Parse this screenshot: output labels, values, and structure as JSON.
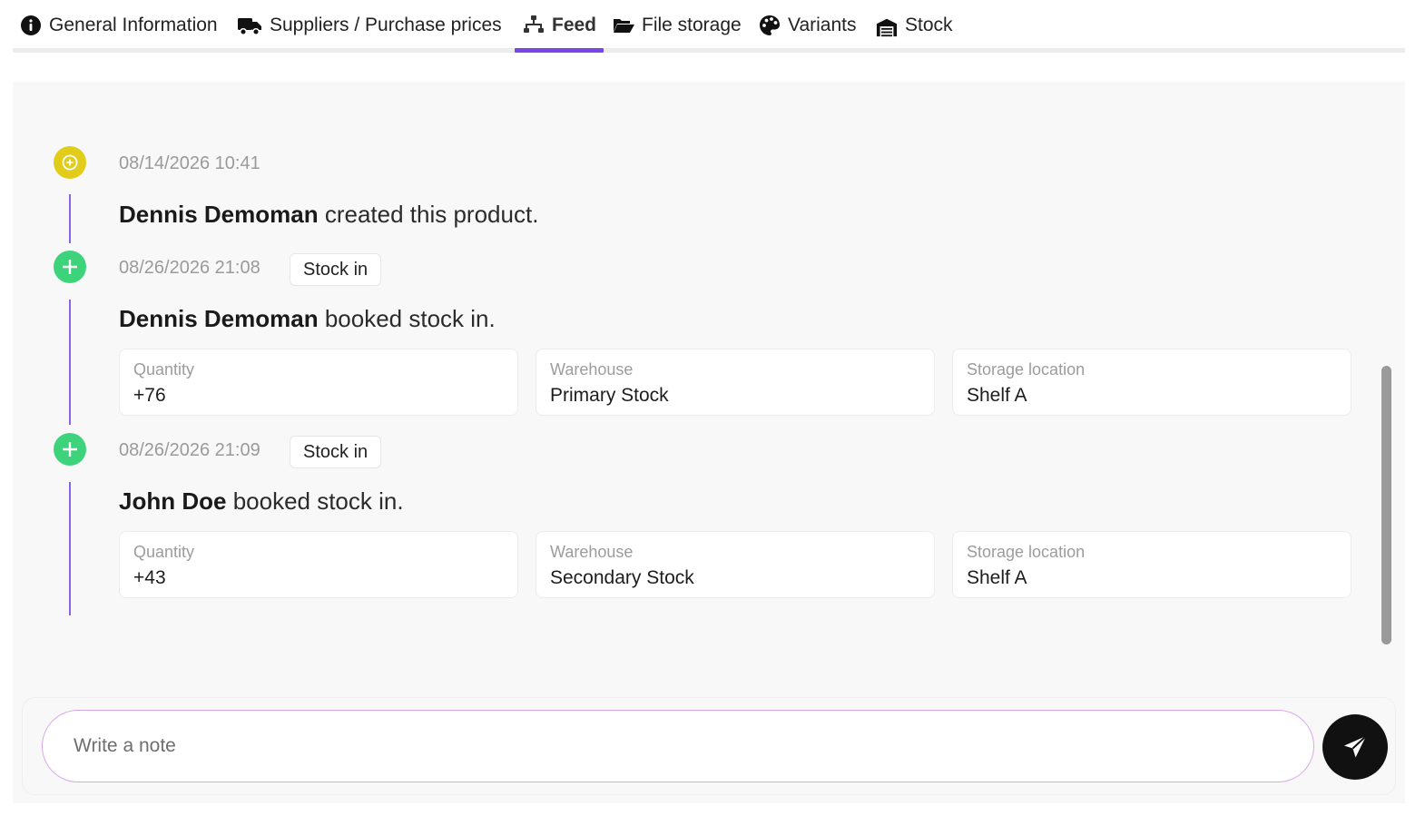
{
  "tabs": [
    {
      "label": "General Information",
      "icon": "info-circle-icon"
    },
    {
      "label": "Suppliers / Purchase prices",
      "icon": "truck-icon"
    },
    {
      "label": "Feed",
      "icon": "sitemap-icon",
      "active": true
    },
    {
      "label": "File storage",
      "icon": "folder-open-icon"
    },
    {
      "label": "Variants",
      "icon": "palette-icon"
    },
    {
      "label": "Stock",
      "icon": "warehouse-icon"
    }
  ],
  "accent_color": "#7a45e6",
  "feed": [
    {
      "timestamp": "08/14/2026 10:41",
      "marker_icon": "plus-circle-icon",
      "marker_color": "#e2cc1a",
      "user": "Dennis Demoman",
      "action": "created this product."
    },
    {
      "timestamp": "08/26/2026 21:08",
      "badge": "Stock in",
      "marker_icon": "plus-icon",
      "marker_color": "#3dd37a",
      "user": "Dennis Demoman",
      "action": "booked stock in.",
      "fields": [
        {
          "label": "Quantity",
          "value": "+76"
        },
        {
          "label": "Warehouse",
          "value": "Primary Stock"
        },
        {
          "label": "Storage location",
          "value": "Shelf A"
        }
      ]
    },
    {
      "timestamp": "08/26/2026 21:09",
      "badge": "Stock in",
      "marker_icon": "plus-icon",
      "marker_color": "#3dd37a",
      "user": "John Doe",
      "action": "booked stock in.",
      "fields": [
        {
          "label": "Quantity",
          "value": "+43"
        },
        {
          "label": "Warehouse",
          "value": "Secondary Stock"
        },
        {
          "label": "Storage location",
          "value": "Shelf A"
        }
      ]
    }
  ],
  "composer": {
    "placeholder": "Write a note",
    "value": "",
    "send_icon": "paper-plane-icon"
  }
}
